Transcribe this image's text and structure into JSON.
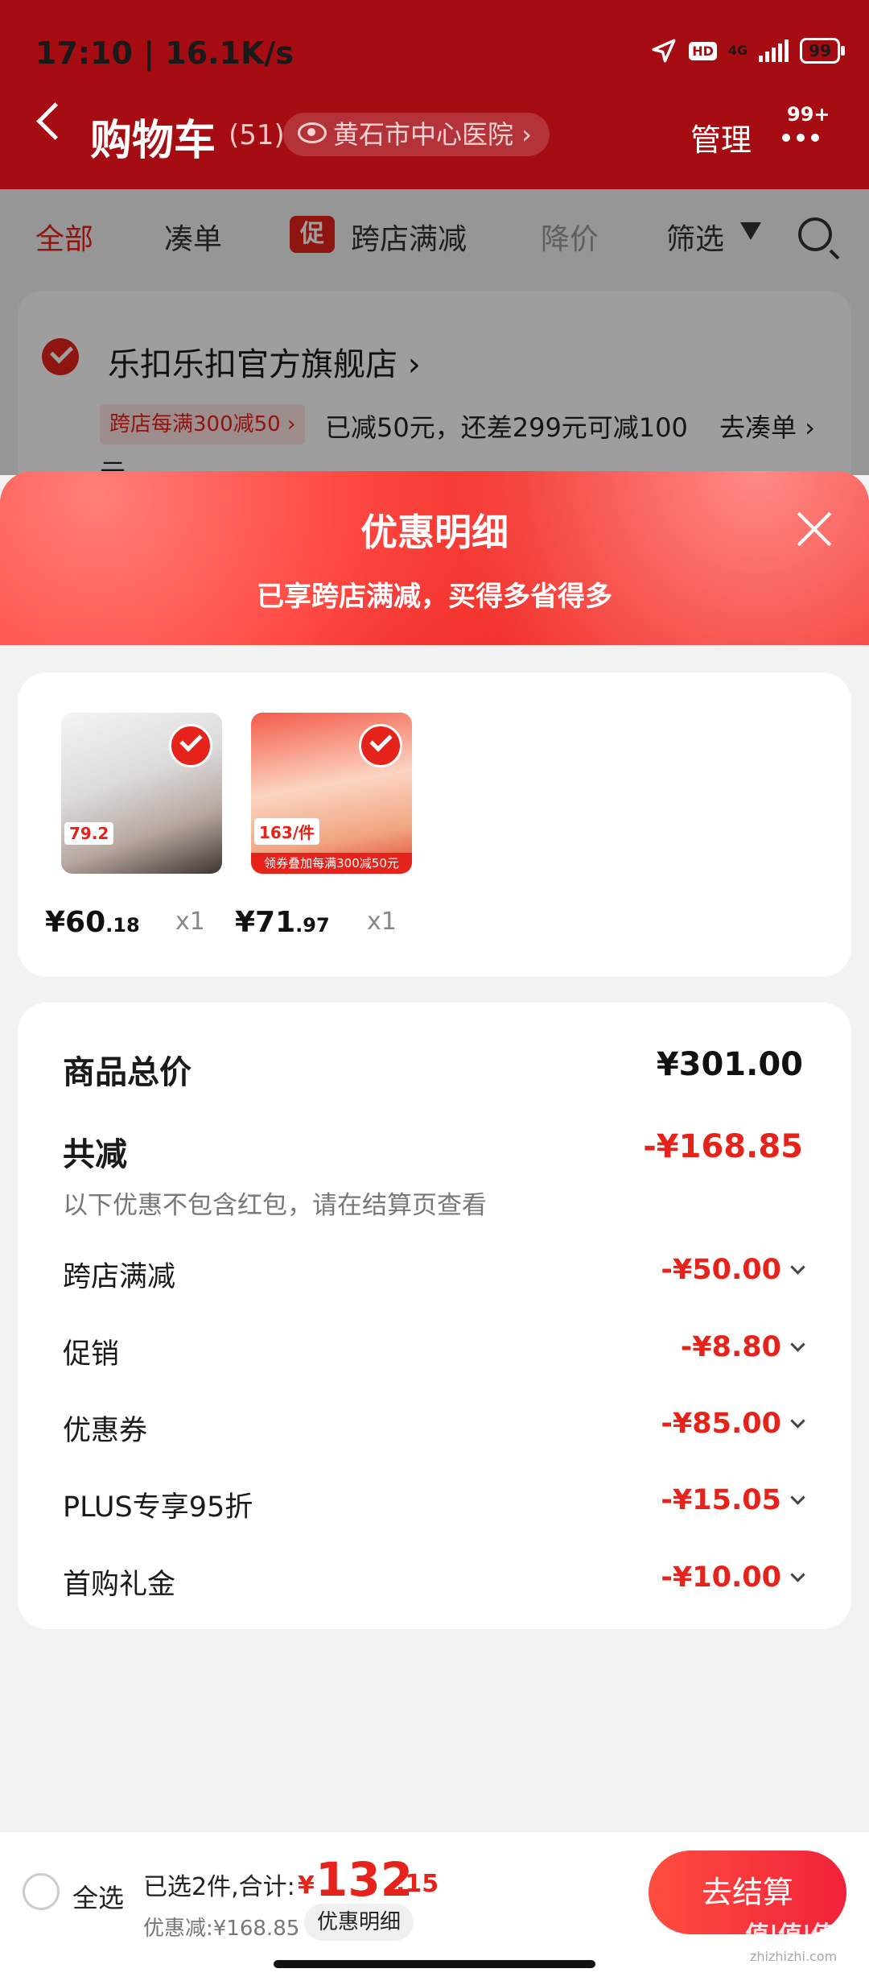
{
  "status": {
    "time_speed": "17:10 | 16.1K/s",
    "hd": "HD",
    "network": "4G",
    "battery": "99"
  },
  "header": {
    "title": "购物车",
    "count": "(51)",
    "location": "黄石市中心医院 ›",
    "manage": "管理",
    "message_badge": "99+"
  },
  "filters": {
    "all": "全部",
    "combine": "凑单",
    "promo_chip": "促",
    "cross_store": "跨店满减",
    "price_drop": "降价",
    "filter": "筛选"
  },
  "store": {
    "name": "乐扣乐扣官方旗舰店 ›",
    "tag": "跨店每满300减50 ›",
    "progress": "已减50元，还差299元可减100",
    "wrap": "元",
    "go": "去凑单 ›"
  },
  "sheet": {
    "title": "优惠明细",
    "subtitle": "已享跨店满减，买得多省得多",
    "products": [
      {
        "price_int": "¥60",
        "price_dec": ".18",
        "qty": "x1",
        "thumb_tag": "79.2",
        "thumb_caption": ""
      },
      {
        "price_int": "¥71",
        "price_dec": ".97",
        "qty": "x1",
        "thumb_tag": "163/件",
        "thumb_caption": "领券叠加每满300减50元"
      }
    ],
    "summary": {
      "total_label": "商品总价",
      "total_value": "¥301.00",
      "reduce_label": "共减",
      "reduce_value": "-¥168.85",
      "note": "以下优惠不包含红包，请在结算页查看",
      "rows": [
        {
          "label": "跨店满减",
          "value": "-¥50.00"
        },
        {
          "label": "促销",
          "value": "-¥8.80"
        },
        {
          "label": "优惠券",
          "value": "-¥85.00"
        },
        {
          "label": "PLUS专享95折",
          "value": "-¥15.05"
        },
        {
          "label": "首购礼金",
          "value": "-¥10.00"
        }
      ]
    }
  },
  "bottom": {
    "select_all": "全选",
    "selected": "已选2件,合计:",
    "yen": "¥",
    "total_int": "132",
    "total_dec": ".15",
    "discount": "优惠减:¥168.85",
    "detail": "优惠明细",
    "checkout": "去结算",
    "watermark": "值|值|值",
    "watermark_url": "zhizhizhi.com"
  },
  "colors": {
    "header_red": "#a50d12",
    "accent_red": "#e5231a"
  }
}
